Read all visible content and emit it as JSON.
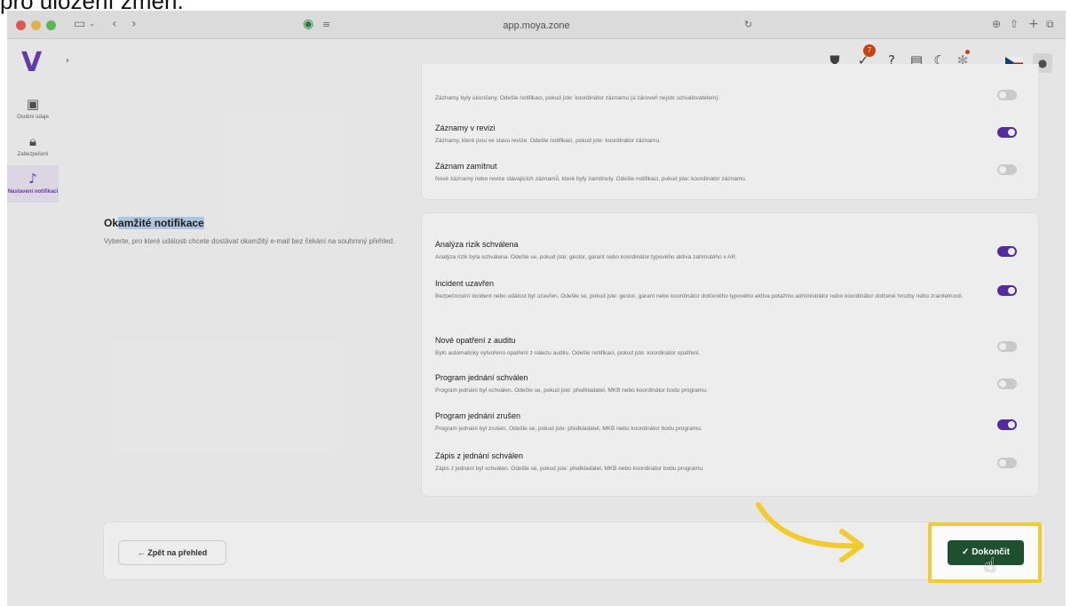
{
  "caption": "pro uložení změn.",
  "browser": {
    "url": "app.moya.zone"
  },
  "header": {
    "logo": "V",
    "notification_count": "7",
    "icons": [
      "shield-icon",
      "task-check-icon",
      "help-icon",
      "news-icon",
      "dark-mode-icon",
      "settings-icon",
      "czech-flag-icon",
      "user-avatar-icon"
    ]
  },
  "sidebar": {
    "items": [
      {
        "label": "Osobní údaje",
        "icon": "clipboard-icon",
        "active": false
      },
      {
        "label": "Zabezpečení",
        "icon": "lock-icon",
        "active": false
      },
      {
        "label": "Nastavení notifikací",
        "icon": "bell-icon",
        "active": true
      }
    ]
  },
  "summary_card": {
    "rows": [
      {
        "title": "",
        "desc": "Záznamy byly ukončeny. Odešle notifikaci, pokud jste: koordinátor záznamu (a zároveň nejste schvalovatelem).",
        "enabled": false
      },
      {
        "title": "Záznamy v revizi",
        "desc": "Záznamy, které jsou ve stavu revize. Odešle notifikaci, pokud jste: koordinátor záznamu.",
        "enabled": true
      },
      {
        "title": "Záznam zamítnut",
        "desc": "Nové záznamy nebo revize stávajících záznamů, které byly zamítnuty. Odešle notifikaci, pokud jste: koordinátor záznamu.",
        "enabled": false
      }
    ]
  },
  "instant_section": {
    "title_plain": "Ok",
    "title_highlighted": "amžité notifikace",
    "description": "Vyberte, pro které události chcete dostávat okamžitý e-mail bez čekání na souhrnný přehled.",
    "rows": [
      {
        "title": "Analýza rizik schválena",
        "desc": "Analýza rizik byla schválena. Odešle se, pokud jste: gestor, garant nebo koordinátor typového aktiva zahrnutého v AR.",
        "enabled": true
      },
      {
        "title": "Incident uzavřen",
        "desc": "Bezpečnostní incident nebo událost byl uzavřen. Odešle se, pokud jste: gestor, garant nebo koordinátor dotčeného typového aktiva potažmo administrátor nebo koordinátor dotčené hrozby nebo zranitelnosti.",
        "enabled": true
      },
      {
        "title": "Nové opatření z auditu",
        "desc": "Bylo automaticky vytvořeno opatření z nálezu auditu. Odešle notifikaci, pokud jste: koordinátor opatření.",
        "enabled": false
      },
      {
        "title": "Program jednání schválen",
        "desc": "Program jednání byl schválen. Odešle se, pokud jste: předkladatel, MKB nebo koordinátor bodu programu.",
        "enabled": false
      },
      {
        "title": "Program jednání zrušen",
        "desc": "Program jednání byl zrušen. Odešle se, pokud jste: předkladatel, MKB nebo koordinátor bodu programu.",
        "enabled": true
      },
      {
        "title": "Zápis z jednání schválen",
        "desc": "Zápis z jednání byl schválen. Odešle se, pokud jste: předkladatel, MKB nebo koordinátor bodu programu.",
        "enabled": false
      }
    ]
  },
  "footer": {
    "back_label": "← Zpět na přehled",
    "done_label": "✓ Dokončit"
  },
  "colors": {
    "accent": "#5b2fae",
    "done_button": "#1e4f2e",
    "highlight_frame": "#f2cb2f",
    "arrow": "#f2cb2f"
  }
}
